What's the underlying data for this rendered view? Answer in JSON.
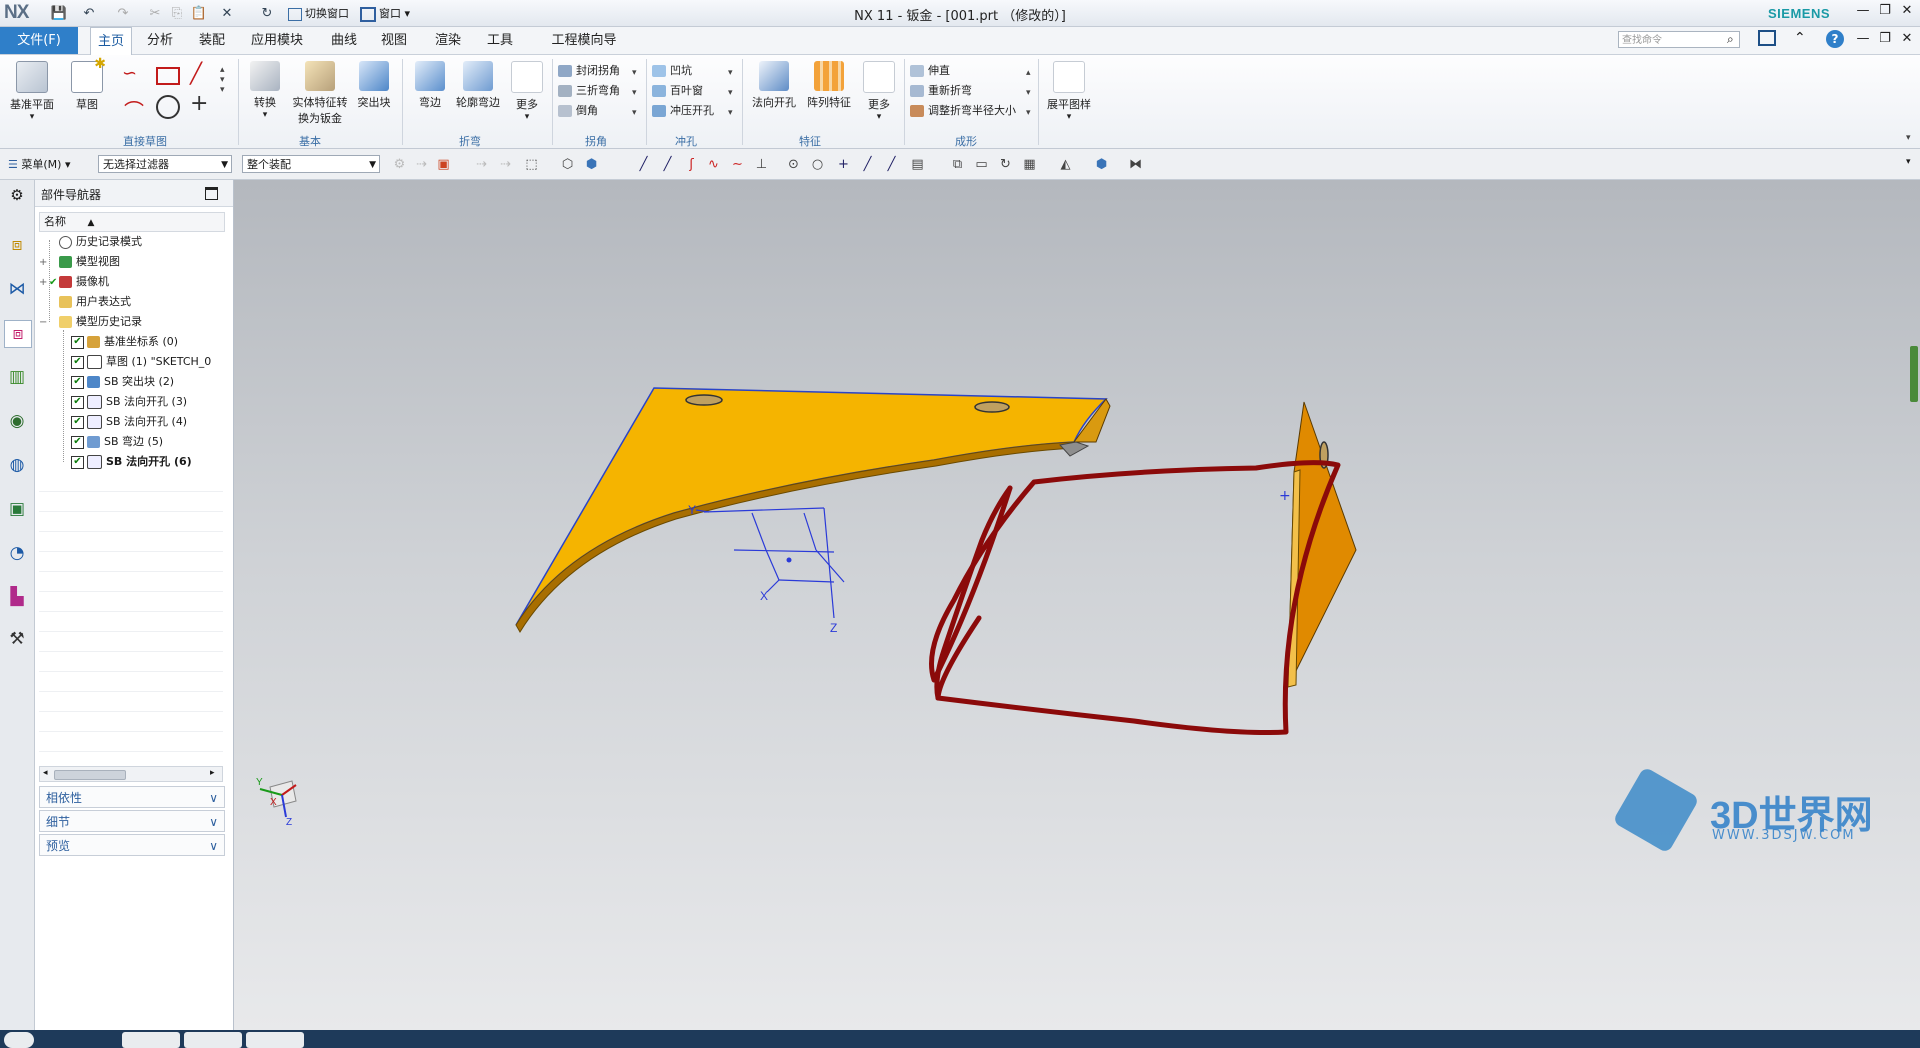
{
  "app": {
    "logo": "NX",
    "window_title": "NX 11 - 钣金 - [001.prt （修改的）]",
    "brand": "SIEMENS",
    "quick_access": {
      "switch_window": "切换窗口",
      "window": "窗口"
    }
  },
  "menu": {
    "file": "文件(F)",
    "tabs": [
      "主页",
      "分析",
      "装配",
      "应用模块",
      "曲线",
      "视图",
      "渲染",
      "工具",
      "工程模向导"
    ],
    "active_tab": "主页",
    "search_placeholder": "查找命令"
  },
  "ribbon": {
    "datum_plane": "基准平面",
    "sketch": "草图",
    "direct_sketch_group": "直接草图",
    "convert": "转换",
    "solid_to_sheet_1": "实体特征转",
    "solid_to_sheet_2": "换为钣金",
    "tab_feature": "突出块",
    "basic_group": "基本",
    "flange": "弯边",
    "contour_flange": "轮廓弯边",
    "more_bend": "更多",
    "bend_group": "折弯",
    "corner_items": [
      "封闭拐角",
      "三折弯角",
      "倒角"
    ],
    "corner_group": "拐角",
    "punch_items": [
      "凹坑",
      "百叶窗",
      "冲压开孔"
    ],
    "punch_group": "冲孔",
    "normal_cutout": "法向开孔",
    "pattern_feature": "阵列特征",
    "more_feature": "更多",
    "feature_group": "特征",
    "form_items": [
      "伸直",
      "重新折弯",
      "调整折弯半径大小"
    ],
    "form_group": "成形",
    "flat_pattern": "展平图样"
  },
  "toolbar": {
    "menu": "菜单(M)",
    "filter": "无选择过滤器",
    "scope": "整个装配"
  },
  "navigator": {
    "title": "部件导航器",
    "column_name": "名称",
    "rows": [
      {
        "label": "历史记录模式",
        "indent": 0
      },
      {
        "label": "模型视图",
        "indent": 0
      },
      {
        "label": "摄像机",
        "indent": 0
      },
      {
        "label": "用户表达式",
        "indent": 0
      },
      {
        "label": "模型历史记录",
        "indent": 0
      },
      {
        "label": "基准坐标系 (0)",
        "indent": 1
      },
      {
        "label": "草图 (1) \"SKETCH_0",
        "indent": 1
      },
      {
        "label": "SB 突出块 (2)",
        "indent": 1
      },
      {
        "label": "SB 法向开孔 (3)",
        "indent": 1
      },
      {
        "label": "SB 法向开孔 (4)",
        "indent": 1
      },
      {
        "label": "SB 弯边 (5)",
        "indent": 1
      },
      {
        "label": "SB 法向开孔 (6)",
        "indent": 1
      }
    ],
    "panels": [
      "相依性",
      "细节",
      "预览"
    ]
  },
  "viewport": {
    "axis_labels": {
      "x": "X",
      "y": "Y",
      "z": "Z"
    },
    "watermark_main": "3D世界网",
    "watermark_url": "WWW.3DSJW.COM"
  },
  "colors": {
    "part_face": "#f5b400",
    "part_side": "#e08a00",
    "annotation": "#8b0a0a",
    "accent": "#2f7fc9"
  }
}
